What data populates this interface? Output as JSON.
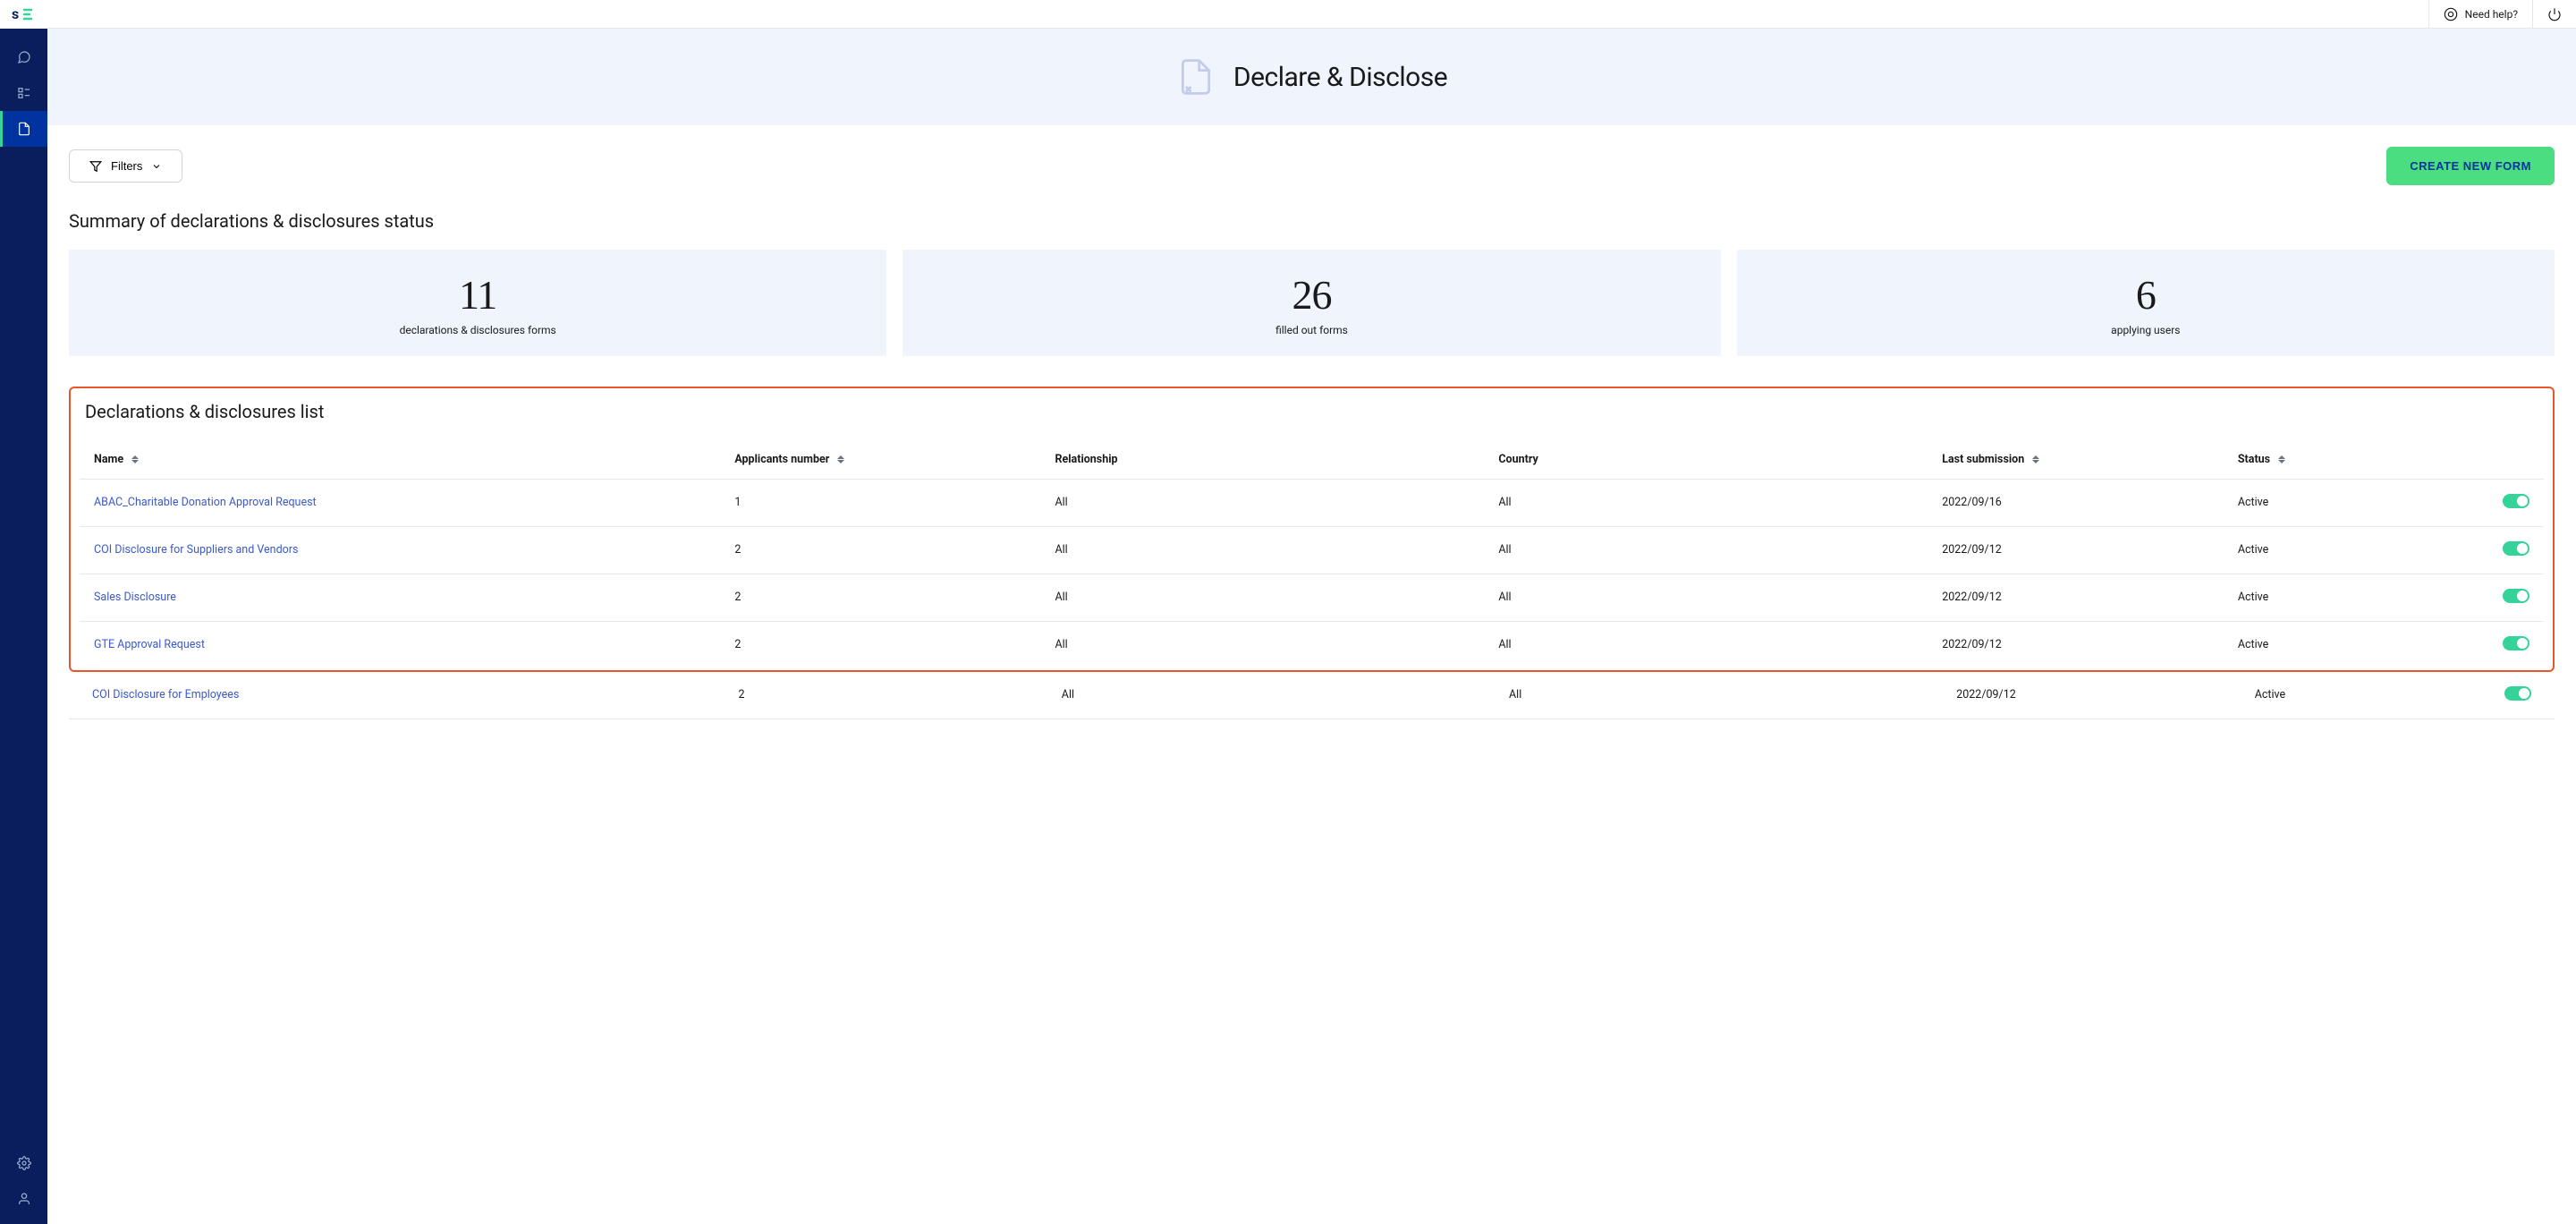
{
  "topbar": {
    "help_label": "Need help?"
  },
  "hero": {
    "title": "Declare & Disclose"
  },
  "toolbar": {
    "filters_label": "Filters",
    "create_label": "CREATE NEW FORM"
  },
  "summary": {
    "title": "Summary of declarations & disclosures status",
    "stats": [
      {
        "value": "11",
        "label": "declarations & disclosures forms"
      },
      {
        "value": "26",
        "label": "filled out forms"
      },
      {
        "value": "6",
        "label": "applying users"
      }
    ]
  },
  "list": {
    "title": "Declarations & disclosures list",
    "columns": {
      "name": "Name",
      "applicants": "Applicants number",
      "relationship": "Relationship",
      "country": "Country",
      "last_submission": "Last submission",
      "status": "Status"
    },
    "rows": [
      {
        "name": "ABAC_Charitable Donation Approval Request",
        "applicants": "1",
        "relationship": "All",
        "country": "All",
        "last_submission": "2022/09/16",
        "status": "Active"
      },
      {
        "name": "COI Disclosure for Suppliers and Vendors",
        "applicants": "2",
        "relationship": "All",
        "country": "All",
        "last_submission": "2022/09/12",
        "status": "Active"
      },
      {
        "name": "Sales Disclosure",
        "applicants": "2",
        "relationship": "All",
        "country": "All",
        "last_submission": "2022/09/12",
        "status": "Active"
      },
      {
        "name": "GTE Approval Request",
        "applicants": "2",
        "relationship": "All",
        "country": "All",
        "last_submission": "2022/09/12",
        "status": "Active"
      }
    ],
    "outside_row": {
      "name": "COI Disclosure for Employees",
      "applicants": "2",
      "relationship": "All",
      "country": "All",
      "last_submission": "2022/09/12",
      "status": "Active"
    }
  }
}
